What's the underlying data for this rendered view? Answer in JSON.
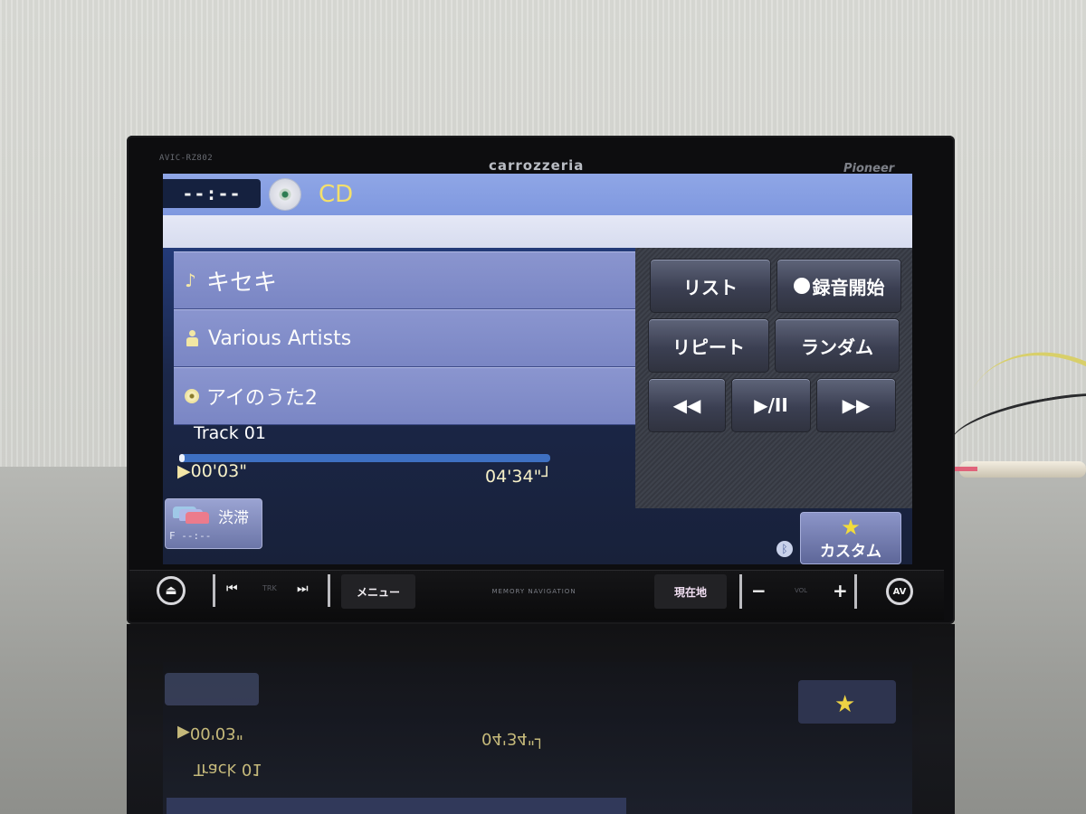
{
  "device": {
    "model": "AVIC-RZ802",
    "brand": "carrozzeria",
    "maker": "Pioneer"
  },
  "screen": {
    "clock": "--:--",
    "source_icon": "cd-disc-icon",
    "source": "CD",
    "now_playing": {
      "title_icon": "music-note-icon",
      "title": "キセキ",
      "artist_icon": "person-icon",
      "artist": "Various Artists",
      "album_icon": "disc-icon",
      "album": "アイのうた2",
      "track": "Track  01",
      "elapsed_icon": "▶",
      "elapsed": "00'03\"",
      "total": "04'34\"┘",
      "progress_fraction": 0.011
    },
    "controls": {
      "list": "リスト",
      "record": "録音開始",
      "repeat": "リピート",
      "random": "ランダム",
      "rewind": "◀◀",
      "play_pause": "▶/II",
      "fast_forward": "▶▶"
    },
    "traffic": {
      "label": "渋滞",
      "time": "F --:--"
    },
    "custom": {
      "icon": "★",
      "label": "カスタム"
    },
    "bluetooth_icon": "ᛒ"
  },
  "hardware": {
    "eject": "⏏",
    "trk_prev": "⏮",
    "trk_label": "TRK",
    "trk_next": "⏭",
    "menu": "メニュー",
    "memory_navigation": "MEMORY NAVIGATION",
    "current_location": "現在地",
    "vol_minus": "−",
    "vol_label": "VOL",
    "vol_plus": "+",
    "av": "AV"
  },
  "reflection": {
    "elapsed": "▶00'03\"",
    "total": "04'34\"┘",
    "track": "Track 01"
  },
  "colors": {
    "accent_yellow": "#f4e06a",
    "header_blue": "#8fa6e6",
    "meta_row": "#8a95cf",
    "button_dark": "#3b3f52",
    "progress": "#3e70c2"
  }
}
